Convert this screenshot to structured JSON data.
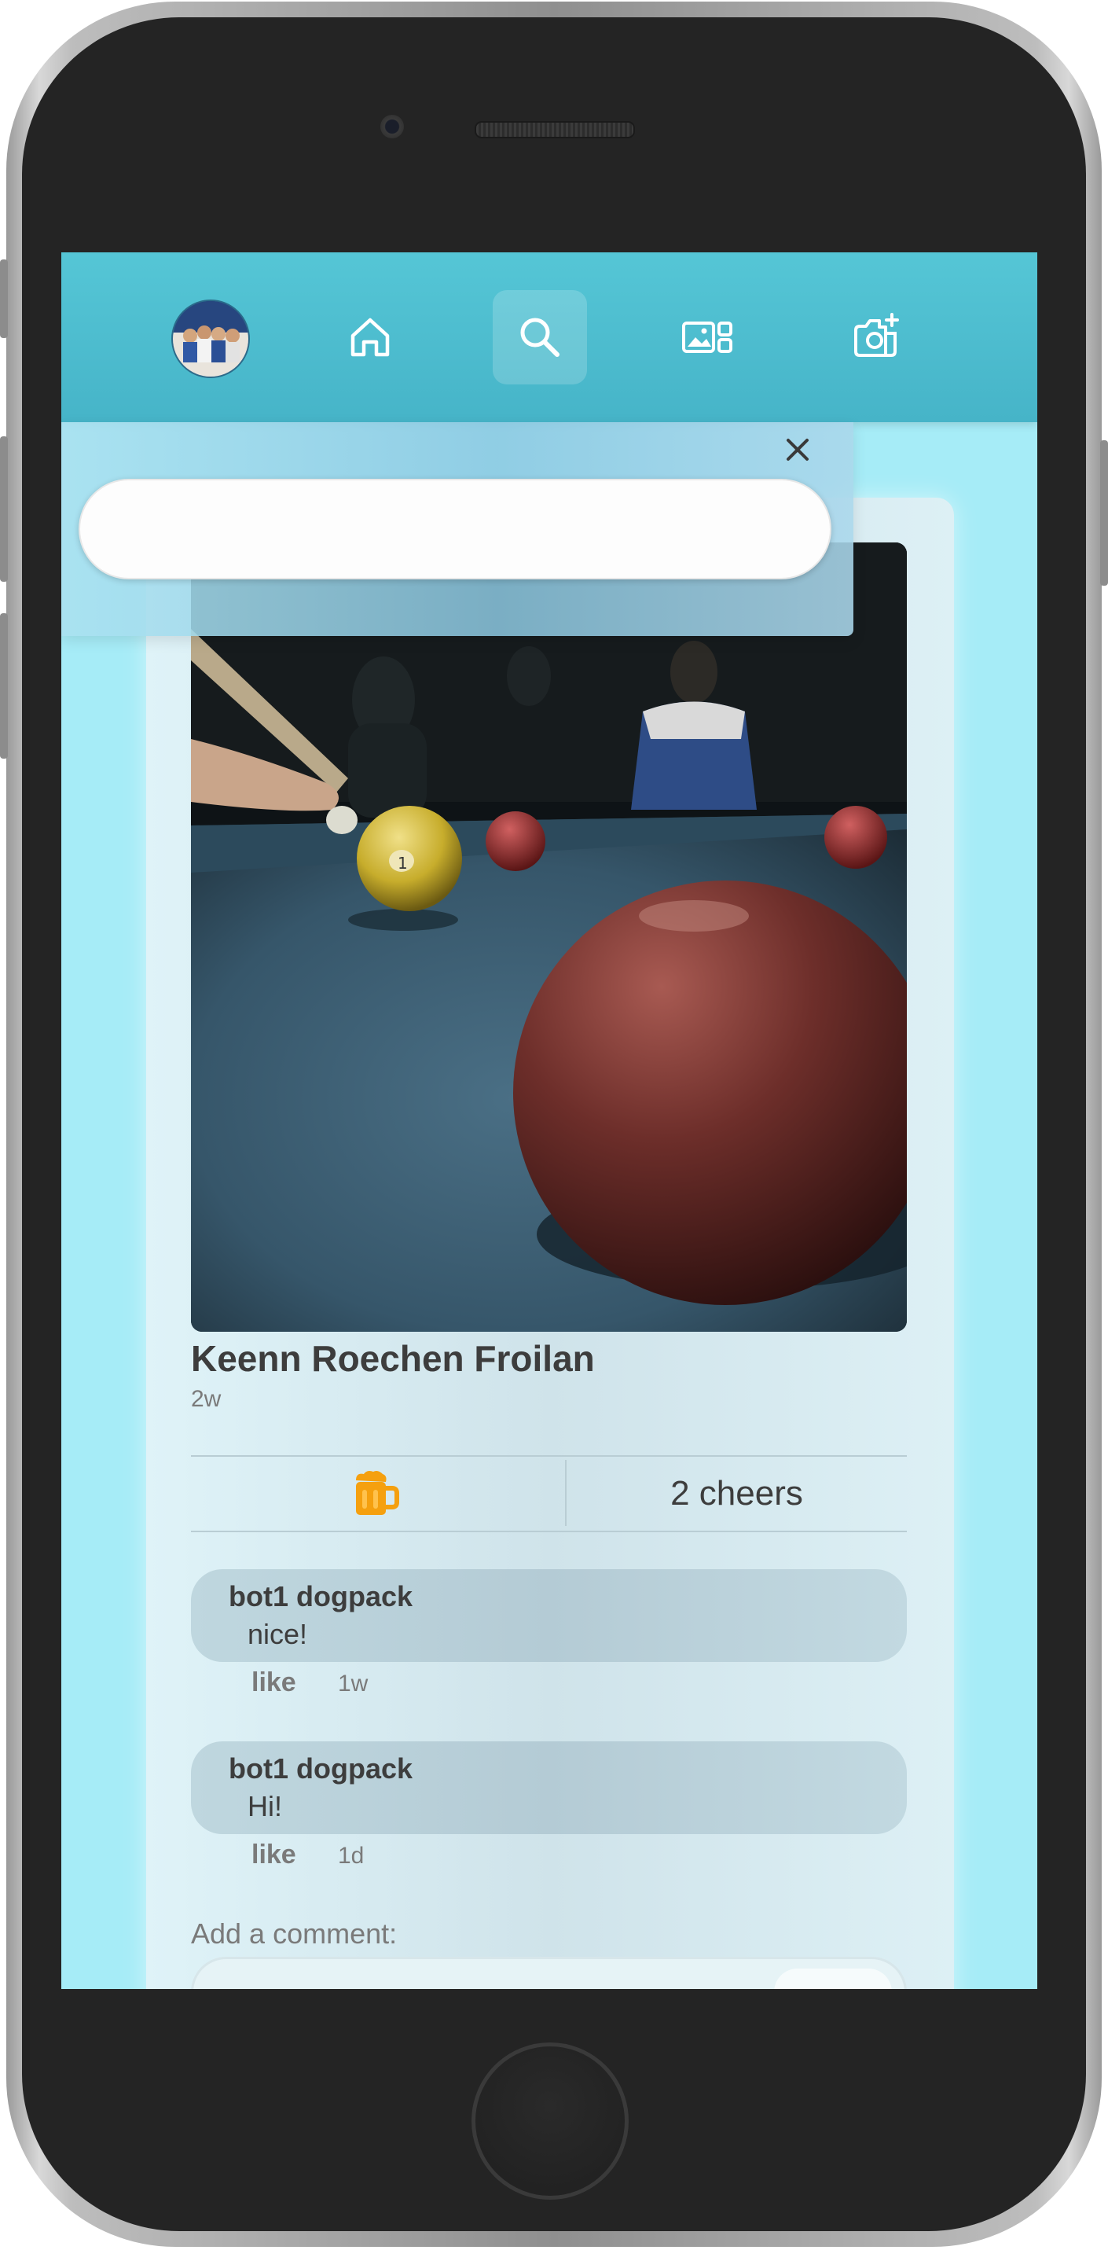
{
  "nav": {
    "items": [
      {
        "name": "profile-avatar",
        "icon": "avatar"
      },
      {
        "name": "home",
        "icon": "home-icon"
      },
      {
        "name": "search",
        "icon": "search-icon",
        "active": true
      },
      {
        "name": "gallery",
        "icon": "gallery-icon"
      },
      {
        "name": "new-photo",
        "icon": "camera-plus-icon"
      }
    ]
  },
  "search": {
    "placeholder": "",
    "value": ""
  },
  "post": {
    "author": "Keenn Roechen Froilan",
    "time": "2w",
    "cheer_icon": "beer-mug-icon",
    "cheer_color": "#f5a00f",
    "cheers_label": "2 cheers"
  },
  "comments": [
    {
      "author": "bot1 dogpack",
      "text": "nice!",
      "like_label": "like",
      "time": "1w"
    },
    {
      "author": "bot1 dogpack",
      "text": "Hi!",
      "like_label": "like",
      "time": "1d"
    }
  ],
  "add_comment": {
    "label": "Add a comment:",
    "placeholder": ""
  },
  "colors": {
    "navbar": "#4fbfd1",
    "background": "#a6ecf7",
    "cheer": "#f5a00f"
  }
}
